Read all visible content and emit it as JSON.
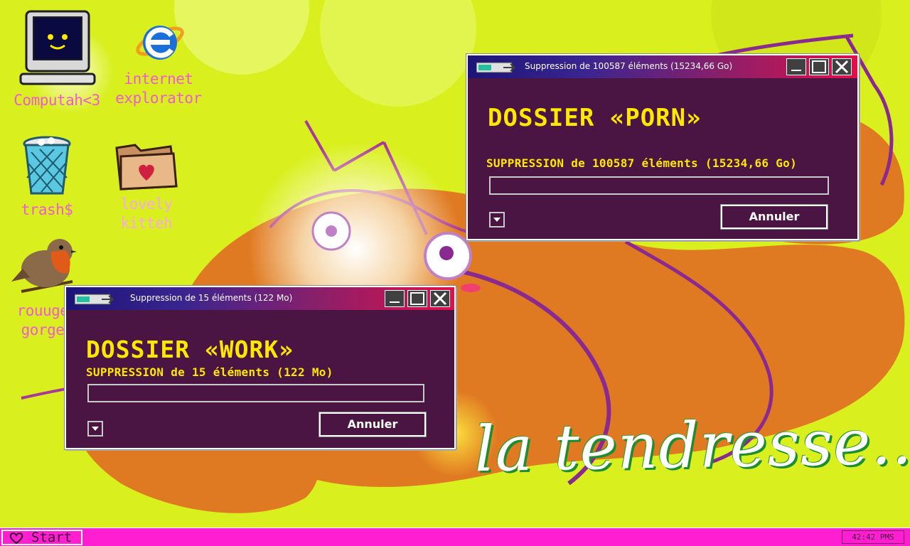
{
  "desktop": {
    "icons": [
      {
        "label": "Computah<3",
        "icon": "computer-icon"
      },
      {
        "label": "internet\nexplorator",
        "icon": "internet-explorer-icon"
      },
      {
        "label": "trash$",
        "icon": "trash-icon"
      },
      {
        "label": "lovely\nkitteh",
        "icon": "folder-heart-icon"
      },
      {
        "label": "rouuge\ngorge",
        "icon": "robin-bird-icon"
      }
    ],
    "slogan": "la tendresse..."
  },
  "dialog_porn": {
    "title": "Suppression de 100587 éléments (15234,66 Go)",
    "heading": "DOSSIER «PORN»",
    "subtitle": "SUPPRESSION de 100587 éléments (15234,66 Go)",
    "progress": 0,
    "cancel_label": "Annuler"
  },
  "dialog_work": {
    "title": "Suppression de 15 éléments (122 Mo)",
    "heading": "DOSSIER «WORK»",
    "subtitle": "SUPPRESSION de 15 éléments (122 Mo)",
    "progress": 0,
    "cancel_label": "Annuler"
  },
  "taskbar": {
    "start_label": "Start",
    "clock": "42:42 PMS"
  },
  "colors": {
    "desktop_bg": "#d9f01e",
    "dialog_bg": "#4a1542",
    "heading_text": "#ffe800",
    "taskbar_bg": "#ff1ed2",
    "icon_label": "#f05cd0"
  }
}
